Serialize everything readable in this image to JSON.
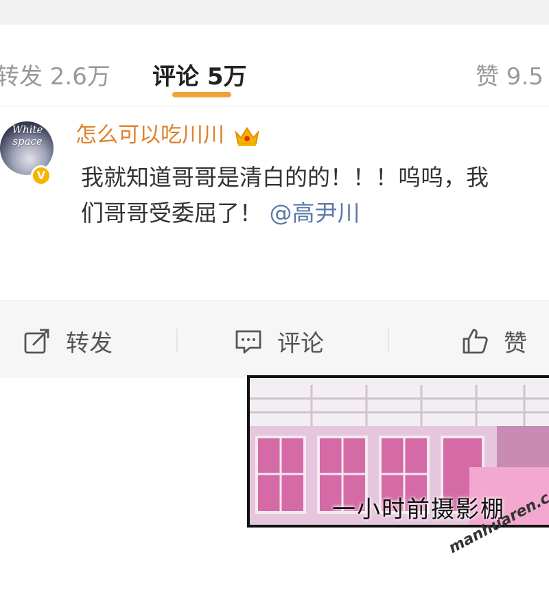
{
  "tabs": [
    {
      "label": "转发 2.6万",
      "active": false
    },
    {
      "label": "评论 5万",
      "active": true
    },
    {
      "label": "赞 9.5",
      "active": false
    }
  ],
  "accent_color": "#f0a23a",
  "comment": {
    "avatar_text": "White space",
    "username": "怎么可以吃川川",
    "username_color": "#e0822b",
    "badge": "crown-icon",
    "verified_badge": "V",
    "text_line1": "我就知道哥哥是清白的的！！！呜呜，我",
    "text_line2": "们哥哥受委屈了！",
    "mention": "@高尹川"
  },
  "actions": [
    {
      "label": "转发",
      "icon": "share-icon"
    },
    {
      "label": "评论",
      "icon": "comment-icon"
    },
    {
      "label": "赞",
      "icon": "thumbs-up-icon"
    }
  ],
  "panel": {
    "caption": "一小时前摄影棚"
  },
  "watermark": "manhuaren.com"
}
